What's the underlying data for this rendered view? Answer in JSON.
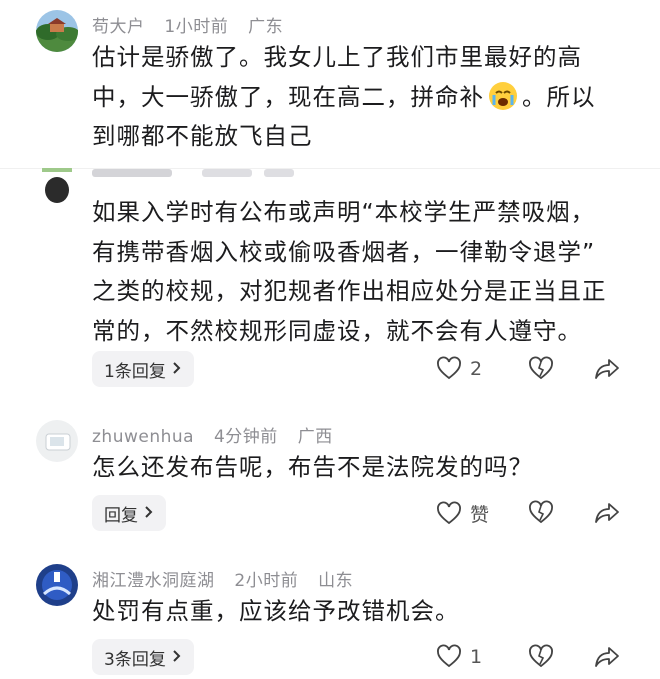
{
  "comments": [
    {
      "author": "苟大户",
      "time": "1小时前",
      "location": "广东",
      "text_lines": [
        "估计是骄傲了。我女儿上了我们市里最好的高",
        "中，大一骄傲了，现在高二，拼命补",
        "。所以",
        "到哪都不能放飞自己"
      ],
      "emoji": "crying-face-emoji"
    },
    {
      "text_lines": [
        "如果入学时有公布或声明“本校学生严禁吸烟，",
        "有携带香烟入校或偷吸香烟者，一律勒令退学”",
        "之类的校规，对犯规者作出相应处分是正当且正",
        "常的，不然校规形同虚设，就不会有人遵守。"
      ],
      "replies_label": "1条回复",
      "like_count": "2"
    },
    {
      "author": "zhuwenhua",
      "time": "4分钟前",
      "location": "广西",
      "text_lines": [
        "怎么还发布告呢，布告不是法院发的吗？"
      ],
      "replies_label": "回复",
      "like_label": "赞"
    },
    {
      "author": "湘江澧水洞庭湖",
      "time": "2小时前",
      "location": "山东",
      "text_lines": [
        "处罚有点重，应该给予改错机会。"
      ],
      "replies_label": "3条回复",
      "like_count": "1"
    }
  ],
  "icons": {
    "like": "heart-icon",
    "dislike": "broken-heart-icon",
    "share": "share-arrow-icon",
    "chevron": "chevron-right-icon"
  },
  "colors": {
    "meta": "#8e8e93",
    "pill_bg": "#f2f2f4",
    "text": "#1c1c1e"
  }
}
